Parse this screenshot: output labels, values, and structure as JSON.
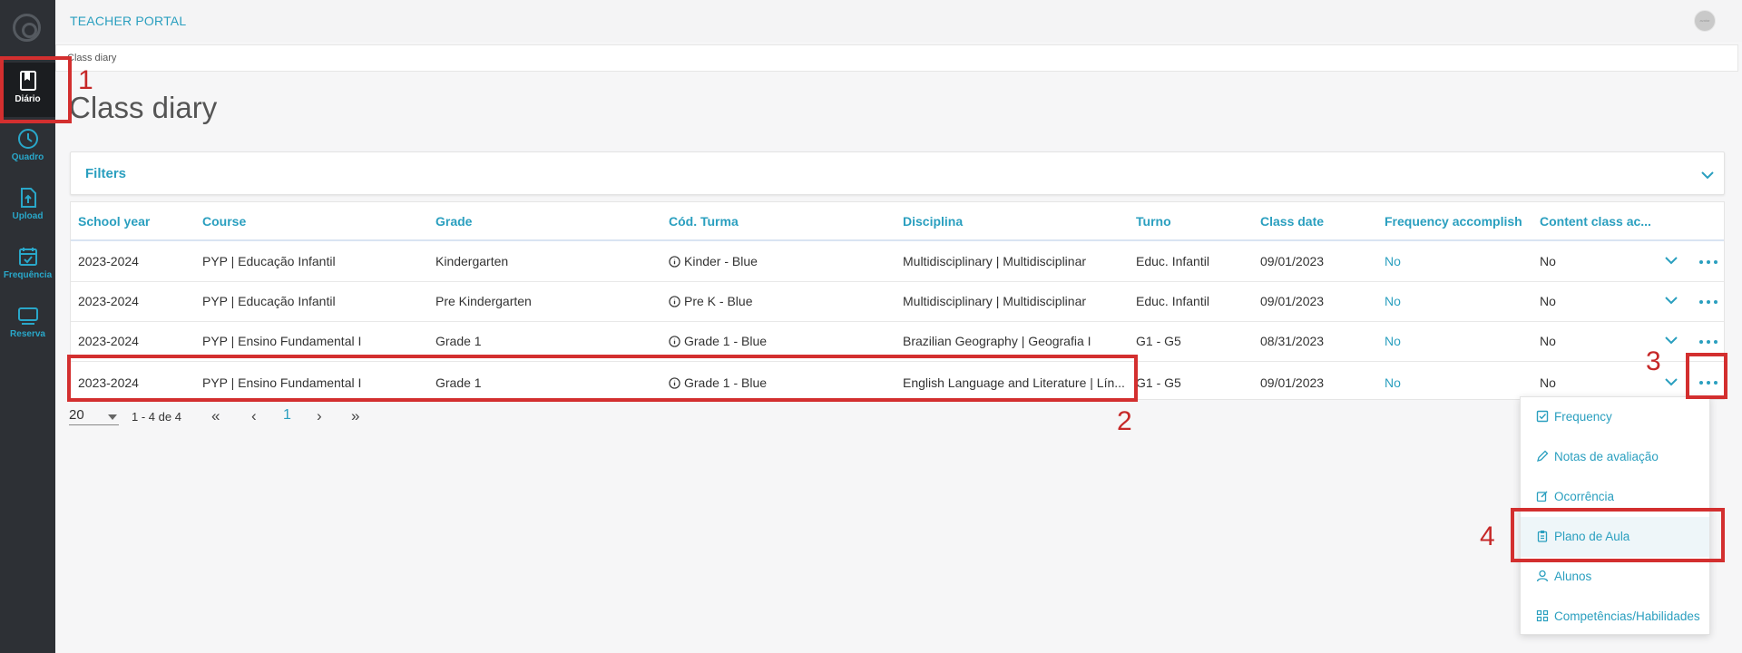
{
  "app": {
    "title": "TEACHER PORTAL",
    "avatar_text": "avatar"
  },
  "sidebar": {
    "items": [
      {
        "label": "Diário",
        "icon": "book-icon"
      },
      {
        "label": "Quadro",
        "icon": "clock-icon"
      },
      {
        "label": "Upload",
        "icon": "upload-icon"
      },
      {
        "label": "Frequência",
        "icon": "calendar-check-icon"
      },
      {
        "label": "Reserva",
        "icon": "monitor-icon"
      }
    ]
  },
  "breadcrumb": "Class diary",
  "page": {
    "title": "Class diary"
  },
  "filters": {
    "label": "Filters"
  },
  "table": {
    "headers": [
      "School year",
      "Course",
      "Grade",
      "Cód. Turma",
      "Disciplina",
      "Turno",
      "Class date",
      "Frequency accomplish",
      "Content class ac..."
    ],
    "rows": [
      [
        "2023-2024",
        "PYP | Educação Infantil",
        "Kindergarten",
        "Kinder - Blue",
        "Multidisciplinary | Multidisciplinar",
        "Educ. Infantil",
        "09/01/2023",
        "No",
        "No"
      ],
      [
        "2023-2024",
        "PYP | Educação Infantil",
        "Pre Kindergarten",
        "Pre K - Blue",
        "Multidisciplinary | Multidisciplinar",
        "Educ. Infantil",
        "09/01/2023",
        "No",
        "No"
      ],
      [
        "2023-2024",
        "PYP | Ensino Fundamental I",
        "Grade 1",
        "Grade 1 - Blue",
        "Brazilian Geography | Geografia I",
        "G1 - G5",
        "08/31/2023",
        "No",
        "No"
      ],
      [
        "2023-2024",
        "PYP | Ensino Fundamental I",
        "Grade 1",
        "Grade 1 - Blue",
        "English Language and Literature | Lín...",
        "G1 - G5",
        "09/01/2023",
        "No",
        "No"
      ]
    ]
  },
  "pagination": {
    "page_size": "20",
    "range": "1 - 4 de 4",
    "current_page": "1",
    "first": "«",
    "prev": "‹",
    "next": "›",
    "last": "»"
  },
  "menu": {
    "items": [
      {
        "label": "Frequency",
        "icon": "checkbox-icon"
      },
      {
        "label": "Notas de avaliação",
        "icon": "pencil-icon"
      },
      {
        "label": "Ocorrência",
        "icon": "edit-note-icon"
      },
      {
        "label": "Plano de Aula",
        "icon": "clipboard-icon"
      },
      {
        "label": "Alunos",
        "icon": "user-icon"
      },
      {
        "label": "Competências/Habilidades",
        "icon": "grid-icon"
      }
    ]
  },
  "annotations": [
    "1",
    "2",
    "3",
    "4"
  ],
  "colors": {
    "accent": "#2a9fbf",
    "sidebar": "#2d3035",
    "annotation": "#d32f2f"
  }
}
